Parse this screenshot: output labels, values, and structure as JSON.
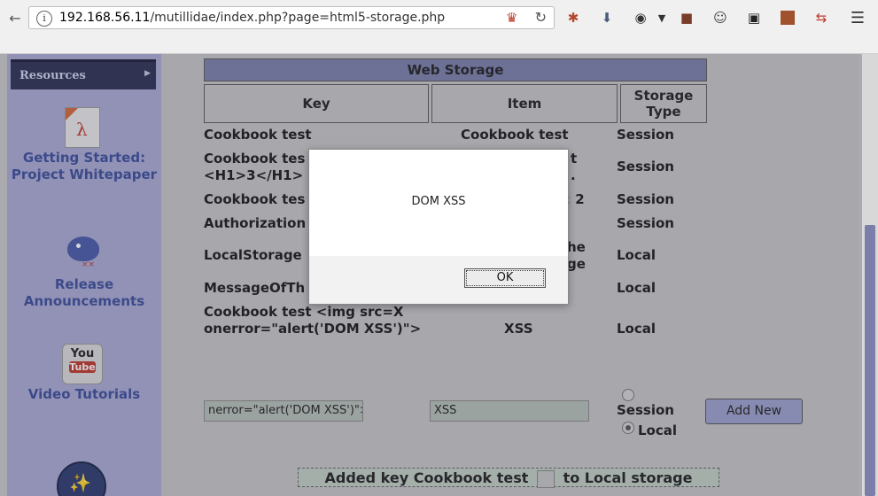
{
  "browser": {
    "url_host": "192.168.56.11",
    "url_path": "/mutillidae/index.php?page=html5-storage.php"
  },
  "sidebar": {
    "menu_label": "Resources",
    "links": [
      {
        "label": "Getting Started: Project Whitepaper"
      },
      {
        "label": "Release Announcements"
      },
      {
        "label": "Video Tutorials"
      }
    ],
    "youtube_icon_text_top": "You",
    "youtube_icon_text_bottom": "Tube"
  },
  "storage": {
    "title": "Web Storage",
    "headers": {
      "key": "Key",
      "item": "Item",
      "type": "Storage Type"
    },
    "rows": [
      {
        "key": "Cookbook test",
        "item": "Cookbook test",
        "type": "Session"
      },
      {
        "key": "Cookbook tes",
        "key2": "<H1>3</H1>",
        "item": "t",
        "item2": ".",
        "type": "Session"
      },
      {
        "key": "Cookbook tes",
        "item": ": 2",
        "type": "Session"
      },
      {
        "key": "Authorization",
        "item": "",
        "type": "Session"
      },
      {
        "key": "LocalStorage",
        "item": "he",
        "item2": "ge",
        "type": "Local"
      },
      {
        "key": "MessageOfTh",
        "item": "",
        "type": "Local"
      },
      {
        "key": "Cookbook test <img src=X onerror=\"alert('DOM XSS')\">",
        "item": "XSS",
        "type": "Local"
      }
    ]
  },
  "form": {
    "key_value": "nerror=\"alert('DOM XSS')\">",
    "item_value": "XSS",
    "session_label": "Session",
    "local_label": "Local",
    "add_button": "Add New"
  },
  "status": {
    "prefix": "Added key Cookbook test",
    "suffix": "to Local storage"
  },
  "dialog": {
    "message": "DOM XSS",
    "ok_label": "OK"
  }
}
